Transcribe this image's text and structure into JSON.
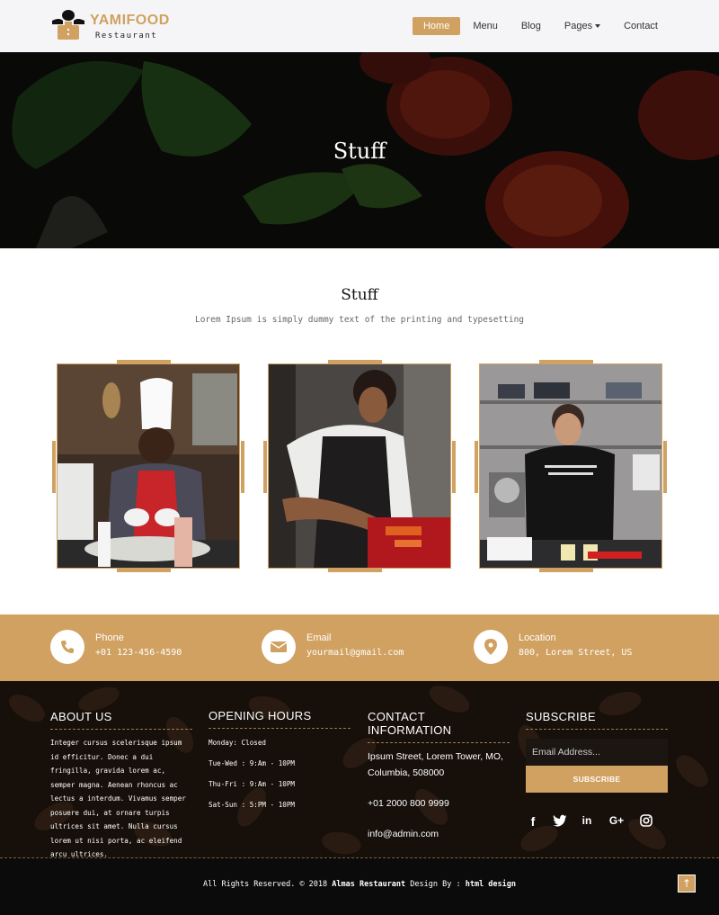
{
  "brand": {
    "name": "YAMIFOOD",
    "sub": "Restaurant",
    "color": "#d0a161"
  },
  "nav": {
    "items": [
      "Home",
      "Menu",
      "Blog",
      "Pages",
      "Contact"
    ],
    "active": "Home"
  },
  "hero": {
    "title": "Stuff"
  },
  "section": {
    "title": "Stuff",
    "subtitle": "Lorem Ipsum is simply dummy text of the printing and typesetting"
  },
  "cards": [
    {
      "photo": "chef-photo"
    },
    {
      "photo": "cook-photo"
    },
    {
      "photo": "kitchen-photo"
    }
  ],
  "contact_strip": {
    "phone": {
      "label": "Phone",
      "value": "+01 123-456-4590",
      "icon": "phone-icon"
    },
    "email": {
      "label": "Email",
      "value": "yourmail@gmail.com",
      "icon": "envelope-icon"
    },
    "location": {
      "label": "Location",
      "value": "800, Lorem Street, US",
      "icon": "map-marker-icon"
    }
  },
  "footer": {
    "about": {
      "heading": "ABOUT US",
      "text": "Integer cursus scelerisque ipsum id efficitur. Donec a dui fringilla, gravida lorem ac, semper magna. Aenean rhoncus ac lectus a interdum. Vivamus semper posuere dui, at ornare turpis ultrices sit amet. Nulla cursus lorem ut nisi porta, ac eleifend arcu ultrices."
    },
    "hours": {
      "heading": "OPENING HOURS",
      "lines": [
        "Monday: Closed",
        "Tue-Wed : 9:Am - 10PM",
        "Thu-Fri : 9:Am - 10PM",
        "Sat-Sun : 5:PM - 10PM"
      ]
    },
    "contact": {
      "heading": "CONTACT INFORMATION",
      "address": "Ipsum Street, Lorem Tower, MO, Columbia, 508000",
      "phone": "+01 2000 800 9999",
      "email": "info@admin.com"
    },
    "subscribe": {
      "heading": "SUBSCRIBE",
      "placeholder": "Email Address...",
      "button": "SUBSCRIBE",
      "socials": [
        "f",
        "t",
        "in",
        "G+",
        "ig"
      ]
    }
  },
  "bottom": {
    "copy_prefix": "All Rights Reserved. © 2018 ",
    "company": "Almas Restaurant",
    "design_by": " Design By : ",
    "designer": "html design",
    "top_button": "↑"
  }
}
